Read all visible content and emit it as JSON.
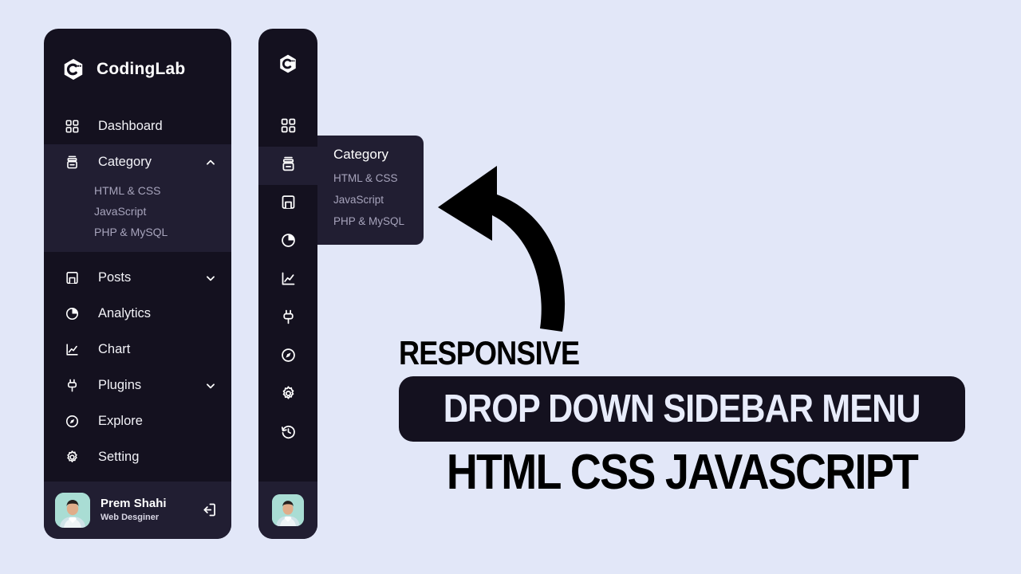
{
  "page": {
    "background_color": "#e2e7f8"
  },
  "theme": {
    "sidebar_bg": "#14111f",
    "sidebar_active_bg": "#211e32",
    "text_primary": "#f2f2f7",
    "text_muted": "#a7a4bc",
    "banner_bg": "#14111f",
    "banner_text": "#e8ecfb"
  },
  "expanded_sidebar": {
    "brand": {
      "logo_icon": "hexagon-c-logo-icon",
      "name": "CodingLab"
    },
    "items": [
      {
        "label": "Dashboard",
        "icon": "grid-icon",
        "has_arrow": false,
        "arrow": "",
        "expanded": false
      },
      {
        "label": "Category",
        "icon": "archive-icon",
        "has_arrow": true,
        "arrow": "chevron-up",
        "expanded": true
      },
      {
        "label": "Posts",
        "icon": "book-icon",
        "has_arrow": true,
        "arrow": "chevron-down",
        "expanded": false
      },
      {
        "label": "Analytics",
        "icon": "pie-chart-icon",
        "has_arrow": false,
        "arrow": "",
        "expanded": false
      },
      {
        "label": "Chart",
        "icon": "line-chart-icon",
        "has_arrow": false,
        "arrow": "",
        "expanded": false
      },
      {
        "label": "Plugins",
        "icon": "plug-icon",
        "has_arrow": true,
        "arrow": "chevron-down",
        "expanded": false
      },
      {
        "label": "Explore",
        "icon": "compass-icon",
        "has_arrow": false,
        "arrow": "",
        "expanded": false
      },
      {
        "label": "Setting",
        "icon": "gear-icon",
        "has_arrow": false,
        "arrow": "",
        "expanded": false
      }
    ],
    "category_submenu": [
      "HTML & CSS",
      "JavaScript",
      "PHP & MySQL"
    ],
    "profile": {
      "avatar_icon": "user-avatar-photo",
      "name": "Prem Shahi",
      "role": "Web Desginer",
      "logout_icon": "logout-icon"
    }
  },
  "collapsed_sidebar": {
    "brand_logo_icon": "hexagon-c-logo-icon",
    "icons": [
      {
        "name": "grid-icon",
        "tooltip": "Dashboard",
        "active": false
      },
      {
        "name": "archive-icon",
        "tooltip": "Category",
        "active": true
      },
      {
        "name": "book-icon",
        "tooltip": "Posts",
        "active": false
      },
      {
        "name": "pie-chart-icon",
        "tooltip": "Analytics",
        "active": false
      },
      {
        "name": "line-chart-icon",
        "tooltip": "Chart",
        "active": false
      },
      {
        "name": "plug-icon",
        "tooltip": "Plugins",
        "active": false
      },
      {
        "name": "compass-icon",
        "tooltip": "Explore",
        "active": false
      },
      {
        "name": "gear-icon",
        "tooltip": "Setting",
        "active": false
      },
      {
        "name": "history-icon",
        "tooltip": "History",
        "active": false
      }
    ],
    "profile_avatar_icon": "user-avatar-photo"
  },
  "flyout_menu": {
    "title": "Category",
    "items": [
      "HTML & CSS",
      "JavaScript",
      "PHP & MySQL"
    ]
  },
  "promo": {
    "kicker": "RESPONSIVE",
    "banner": "DROP DOWN SIDEBAR MENU",
    "subtitle": "HTML CSS JAVASCRIPT",
    "arrow_icon": "curved-arrow-left-icon"
  }
}
